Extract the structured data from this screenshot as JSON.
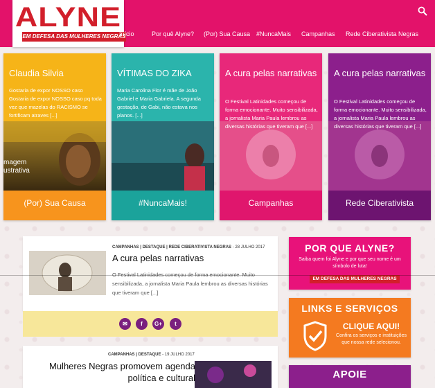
{
  "header": {
    "logo_text": "ALYNE",
    "logo_subtitle": "EM DEFESA DAS MULHERES NEGRAS",
    "nav": [
      "Início",
      "Por quê Alyne?",
      "(Por) Sua Causa",
      "#NuncaMais",
      "Campanhas",
      "Rede Ciberativista Negras"
    ],
    "search_icon": "search-icon"
  },
  "cards": [
    {
      "title": "Claudia Silvia",
      "excerpt": "Gostaria de expor NOSSO caso Gostaria de expor NOSSO caso pq toda vez que mazelas do RACISMO se fortificam atraves [...]",
      "photo_caption_1": "magem",
      "photo_caption_2": "ustrativa",
      "footer": "(Por) Sua Causa",
      "color": "#f6b418",
      "footer_color": "#f7941d"
    },
    {
      "title": "VÍTIMAS DO ZIKA",
      "excerpt": "Maria Carolina Flor é mãe de João Gabriel e Maria Gabriela. A segunda gestação, de Gabi, não estava nos planos. [...]",
      "footer": "#NuncaMais!",
      "color": "#2bb4ac",
      "footer_color": "#1ba39b"
    },
    {
      "title": "A cura pelas narrativas",
      "excerpt": "O Festival Latinidades começou de forma emocionante. Muito sensibilizada, a jornalista Maria Paula lembrou as diversas histórias que tiveram que [...]",
      "footer": "Campanhas",
      "color": "#e8287a",
      "footer_color": "#e0166d"
    },
    {
      "title": "A cura pelas narrativas",
      "excerpt": "O Festival Latinidades começou de forma emocionante. Muito sensibilizada, a jornalista Maria Paula lembrou as diversas histórias que tiveram que [...]",
      "footer": "Rede Ciberativista",
      "color": "#8c1f8c",
      "footer_color": "#6d1470"
    }
  ],
  "posts": [
    {
      "categories": "CAMPANHAS | DESTAQUE | REDE CIBERATIVISTA NEGRAS",
      "date": "- 28 JULHO 2017",
      "title": "A cura pelas narrativas",
      "excerpt": "O Festival Latinidades começou de forma emocionante. Muito sensibilizada, a jornalista Maria Paula lembrou as diversas histórias que tiveram que [...]"
    },
    {
      "categories": "CAMPANHAS | DESTAQUE",
      "date": "- 19 JULHO 2017",
      "title": "Mulheres Negras promovem agenda política e cultural"
    }
  ],
  "share_icons": [
    "email-icon",
    "facebook-icon",
    "google-plus-icon",
    "twitter-icon"
  ],
  "share_glyphs": [
    "✉",
    "f",
    "G+",
    "t"
  ],
  "sidebar": {
    "why": {
      "title": "POR QUE ALYNE?",
      "text": "Saiba quem foi Alyne e por que seu nome é um símbolo de luta!",
      "badge": "EM DEFESA DAS MULHERES NEGRAS",
      "color": "#e8127a"
    },
    "links": {
      "title": "LINKS E SERVIÇOS",
      "cta": "CLIQUE AQUI!",
      "text": "Confira os serviços e instituições que nossa rede selecionou.",
      "color": "#f47a20"
    },
    "apoie": {
      "title": "APOIE",
      "color": "#8c1f8c"
    }
  }
}
